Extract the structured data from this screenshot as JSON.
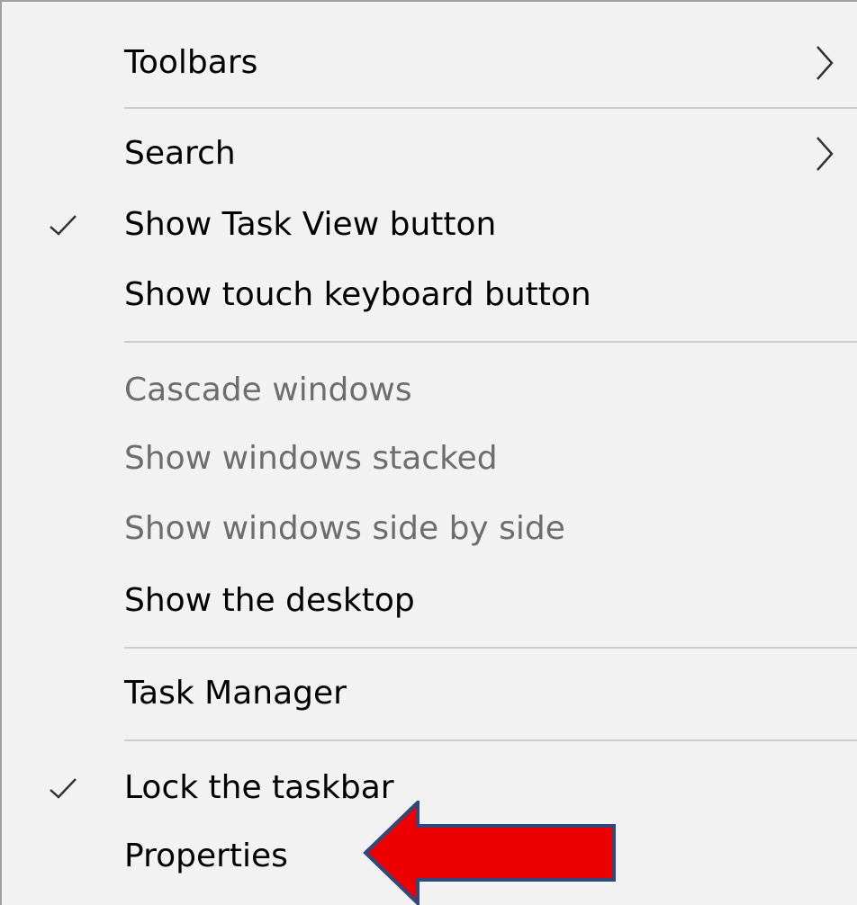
{
  "menu": {
    "items": [
      {
        "label": "Toolbars",
        "submenu": true
      },
      {
        "label": "Search",
        "submenu": true
      },
      {
        "label": "Show Task View button",
        "checked": true
      },
      {
        "label": "Show touch keyboard button"
      },
      {
        "label": "Cascade windows",
        "disabled": true
      },
      {
        "label": "Show windows stacked",
        "disabled": true
      },
      {
        "label": "Show windows side by side",
        "disabled": true
      },
      {
        "label": "Show the desktop"
      },
      {
        "label": "Task Manager"
      },
      {
        "label": "Lock the taskbar",
        "checked": true
      },
      {
        "label": "Properties"
      }
    ]
  },
  "icons": {
    "check": "checkmark-icon",
    "chevron": "chevron-right-icon",
    "annotation": "red-arrow-pointing-left"
  },
  "colors": {
    "menu_background": "#f2f2f2",
    "disabled_text": "#6d6d6d",
    "separator": "#cdcdcd",
    "annotation_arrow_fill": "#ee0000",
    "annotation_arrow_stroke": "#2f4a7a"
  }
}
